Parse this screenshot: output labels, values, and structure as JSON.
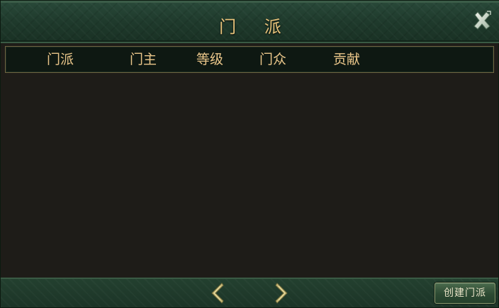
{
  "window": {
    "title": "门 派"
  },
  "table": {
    "columns": [
      "门派",
      "门主",
      "等级",
      "门众",
      "贡献"
    ],
    "rows": []
  },
  "footer": {
    "create_label": "创建门派"
  },
  "icons": {
    "close": "close-x-icon",
    "prev": "arrow-left-icon",
    "next": "arrow-right-icon"
  },
  "colors": {
    "title_gold": "#e6c27a",
    "header_gold": "#eac68a",
    "panel_green": "#1f3a2c",
    "body_dark": "#1e1c18"
  }
}
